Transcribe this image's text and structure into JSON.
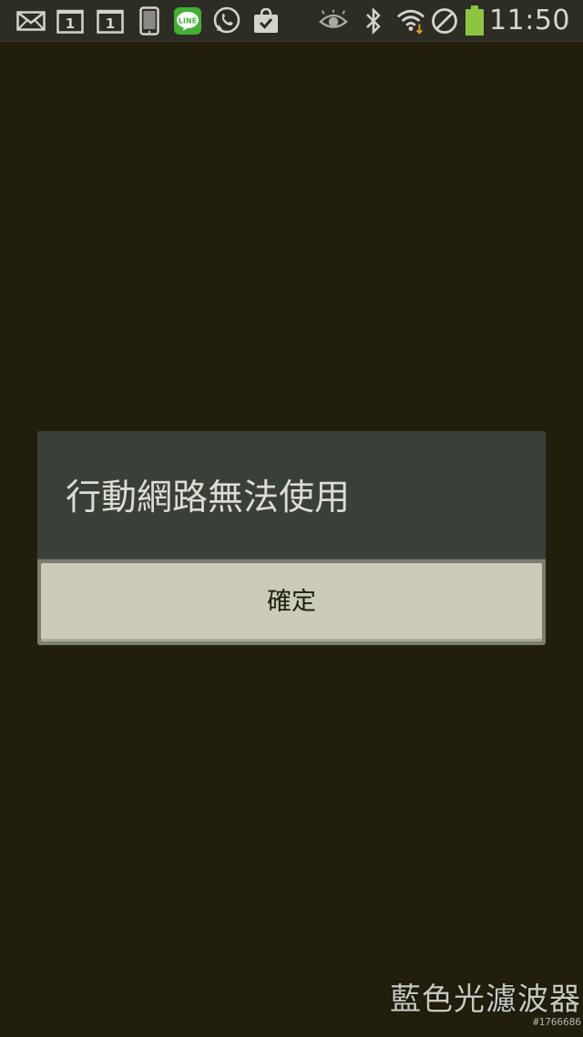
{
  "status_bar": {
    "time": "11:50",
    "calendar_day_1": "1",
    "calendar_day_2": "1",
    "line_badge": "LINE",
    "icons_left": [
      "mail-icon",
      "calendar-icon",
      "calendar-icon",
      "phone-icon",
      "line-app-icon",
      "whatsapp-icon",
      "shopping-bag-icon"
    ],
    "icons_right": [
      "eye-icon",
      "bluetooth-icon",
      "wifi-icon",
      "no-signal-icon",
      "battery-icon"
    ],
    "colors": {
      "battery": "#8cc63f",
      "line": "#41b035"
    }
  },
  "dialog": {
    "title": "行動網路無法使用",
    "confirm_label": "確定"
  },
  "watermark": {
    "text": "藍色光濾波器",
    "id": "#1766686"
  }
}
